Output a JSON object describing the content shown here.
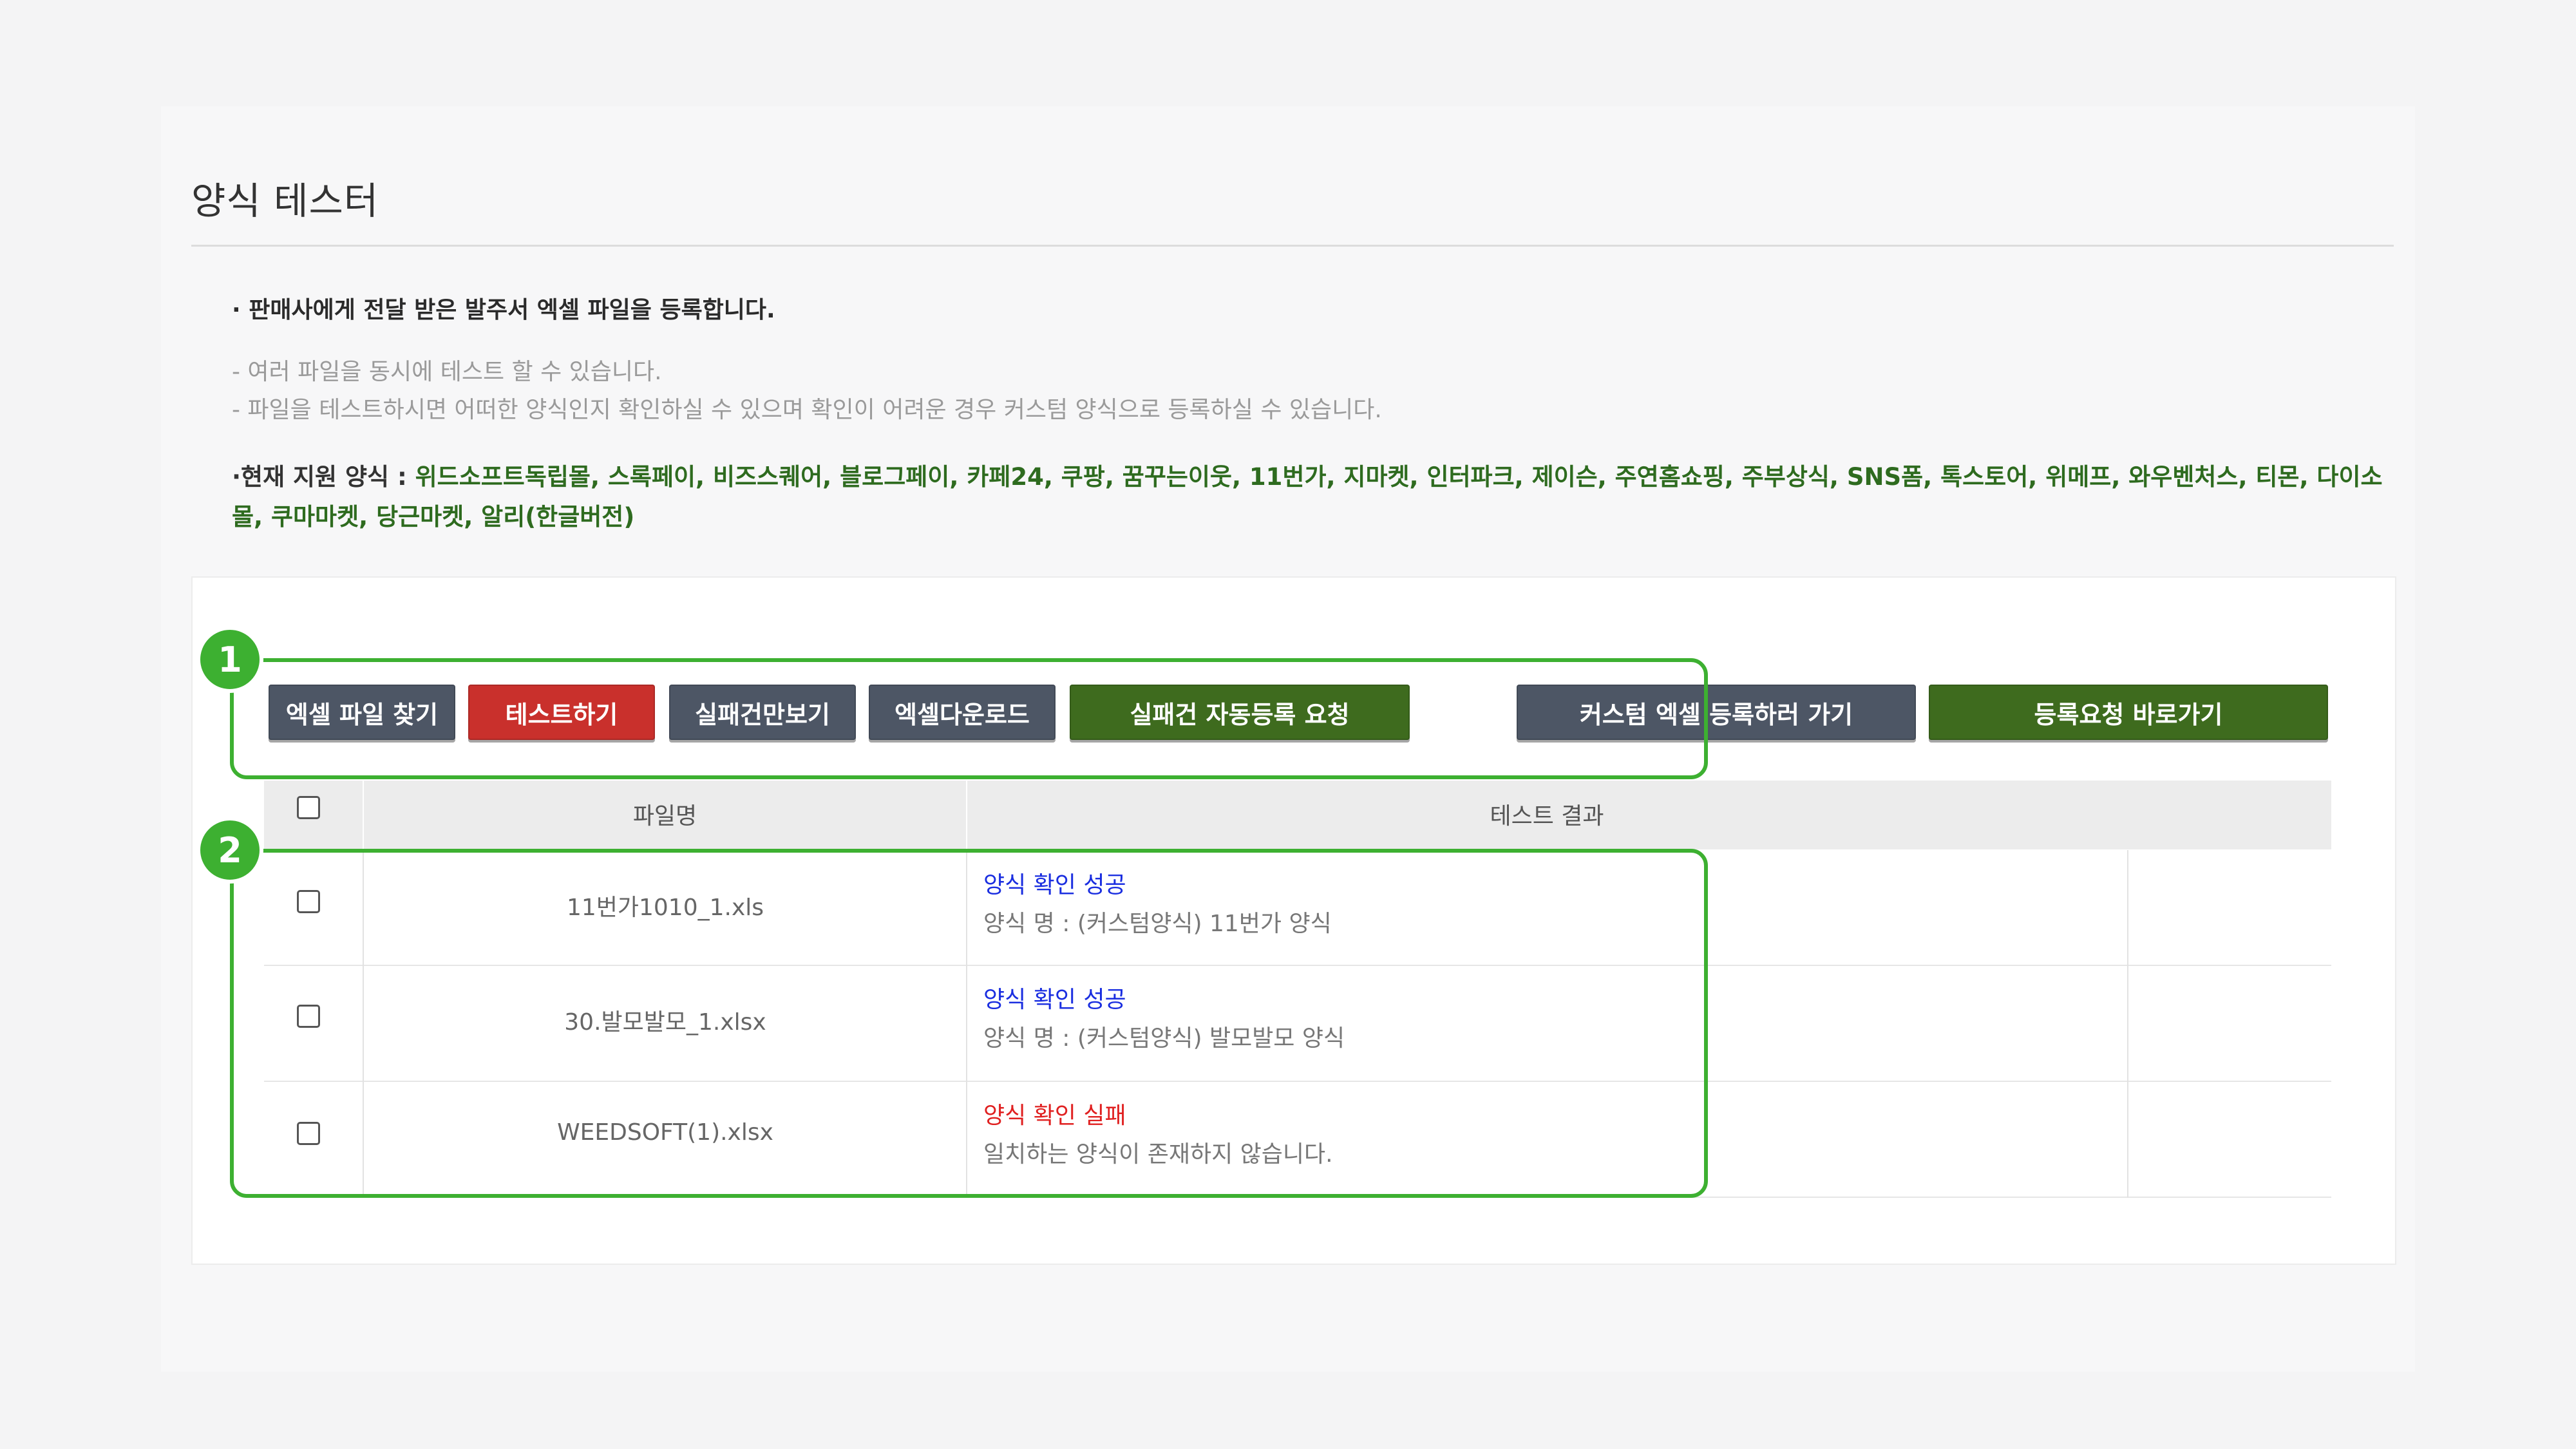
{
  "page": {
    "title": "양식 테스터"
  },
  "intro": {
    "main": "· 판매사에게 전달 받은 발주서 엑셀 파일을 등록합니다.",
    "note1": "- 여러 파일을 동시에 테스트 할 수 있습니다.",
    "note2": "- 파일을 테스트하시면 어떠한 양식인지 확인하실 수 있으며 확인이 어려운 경우 커스텀 양식으로 등록하실 수 있습니다.",
    "support_label": "·현재 지원 양식 : ",
    "support_value": "위드소프트독립몰, 스록페이, 비즈스퀘어, 블로그페이, 카페24, 쿠팡, 꿈꾸는이웃, 11번가, 지마켓, 인터파크, 제이슨, 주연홈쇼핑, 주부상식, SNS폼, 톡스토어, 위메프, 와우벤처스, 티몬, 다이소몰, 쿠마마켓, 당근마켓, 알리(한글버전)"
  },
  "toolbar": {
    "find_excel": "엑셀 파일 찾기",
    "run_test": "테스트하기",
    "failed_only": "실패건만보기",
    "excel_download": "엑셀다운로드",
    "auto_register": "실패건 자동등록 요청",
    "custom_excel": "커스텀 엑셀 등록하러 가기",
    "go_request": "등록요청 바로가기"
  },
  "table": {
    "columns": [
      "",
      "파일명",
      "테스트 결과",
      ""
    ],
    "rows": [
      {
        "file": "11번가1010_1.xls",
        "status": "양식 확인 성공",
        "status_type": "success",
        "detail": "양식 명 : (커스텀양식) 11번가 양식"
      },
      {
        "file": "30.발모발모_1.xlsx",
        "status": "양식 확인 성공",
        "status_type": "success",
        "detail": "양식 명 : (커스텀양식) 발모발모 양식"
      },
      {
        "file": "WEEDSOFT(1).xlsx",
        "status": "양식 확인 실패",
        "status_type": "fail",
        "detail": "일치하는 양식이 존재하지 않습니다."
      }
    ]
  },
  "callouts": {
    "one": "1",
    "two": "2"
  },
  "colors": {
    "highlight": "#3db031",
    "success": "#1a2ee0",
    "fail": "#e02020",
    "green_button": "#3e6b1e",
    "red_button": "#c9302c",
    "dark_button": "#4d5665"
  }
}
